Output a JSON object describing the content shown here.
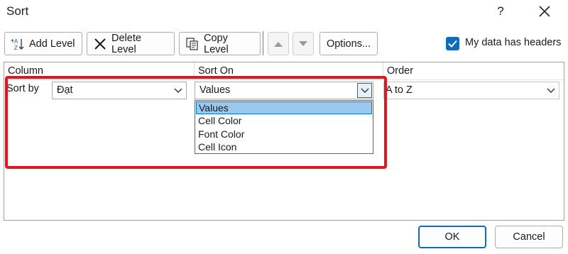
{
  "window": {
    "title": "Sort",
    "help_label": "?"
  },
  "toolbar": {
    "add_level": "Add Level",
    "delete_level": "Delete Level",
    "copy_level": "Copy Level",
    "options": "Options...",
    "my_data_has_headers": "My data has headers",
    "my_data_has_headers_checked": true
  },
  "columns": {
    "column": "Column",
    "sort_on": "Sort On",
    "order": "Order"
  },
  "level": {
    "label": "Sort by",
    "column_value": "Đạt",
    "sort_on_value": "Values",
    "order_value": "A to Z"
  },
  "sort_on_options": [
    "Values",
    "Cell Color",
    "Font Color",
    "Cell Icon"
  ],
  "sort_on_selected_index": 0,
  "buttons": {
    "ok": "OK",
    "cancel": "Cancel"
  },
  "colors": {
    "accent": "#0f6cbd",
    "highlight_annotation": "#e4161f",
    "selected_option_bg": "#99c9ef"
  }
}
